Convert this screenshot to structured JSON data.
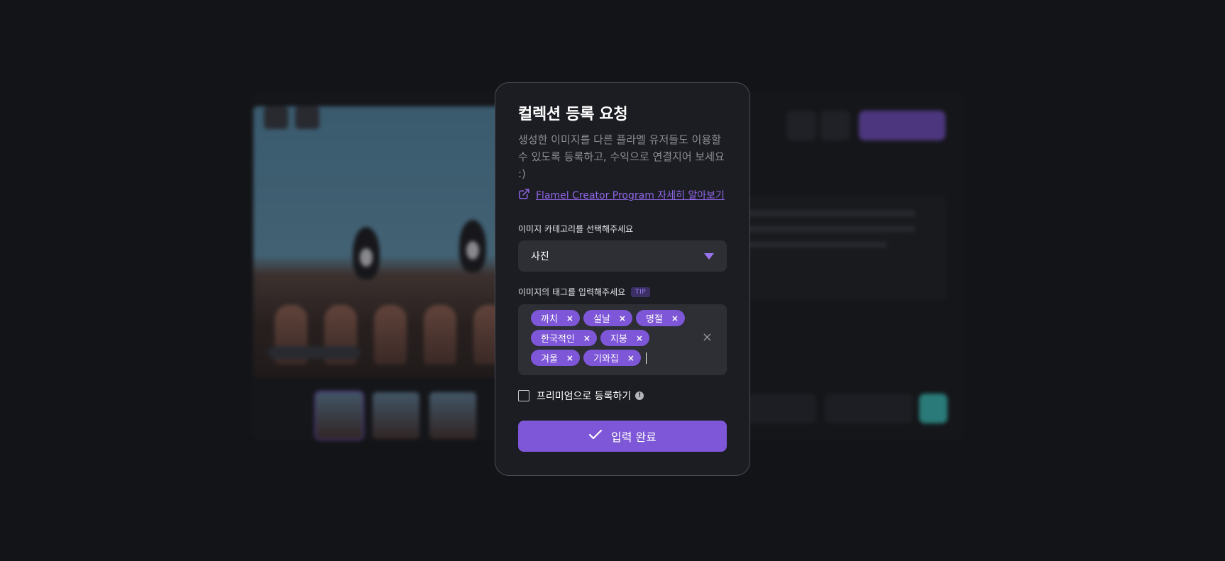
{
  "modal": {
    "title": "컬렉션 등록 요청",
    "subtitle": "생성한 이미지를 다른 플라멜 유저들도 이용할 수 있도록 등록하고, 수익으로 연결지어 보세요 :)",
    "link_label": "Flamel Creator Program 자세히 알아보기",
    "link_icon": "external-link-icon",
    "category": {
      "label": "이미지 카테고리를 선택해주세요",
      "selected": "사진",
      "dropdown_icon": "caret-down-icon"
    },
    "tags": {
      "label": "이미지의 태그를 입력해주세요",
      "tip_badge": "TIP",
      "items": [
        "까치",
        "설날",
        "명절",
        "한국적인",
        "지붕",
        "겨울",
        "기와집"
      ],
      "remove_glyph": "×",
      "clear_all_glyph": "×"
    },
    "premium": {
      "label": "프리미엄으로 등록하기",
      "checked": false,
      "info_glyph": "!"
    },
    "submit": {
      "label": "입력 완료",
      "icon": "checkmark-icon"
    }
  },
  "colors": {
    "accent": "#7e56d8",
    "link": "#8f66e8",
    "modal_bg": "#1c1d22",
    "field_bg": "#2d2f35",
    "page_bg": "#131417"
  }
}
